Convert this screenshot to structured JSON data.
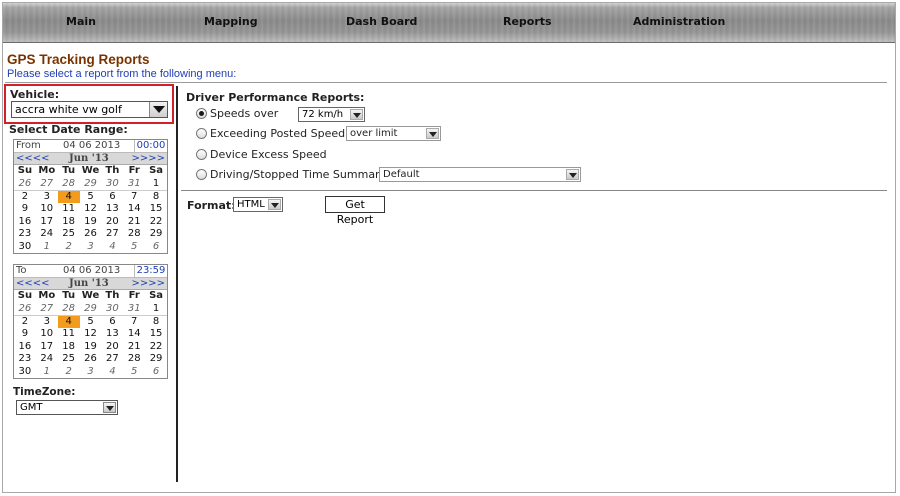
{
  "nav": [
    "Main",
    "Mapping",
    "Dash Board",
    "Reports",
    "Administration"
  ],
  "page": {
    "title": "GPS Tracking Reports",
    "subtitle": "Please select a report from the following menu:"
  },
  "vehicle": {
    "label": "Vehicle:",
    "value": "accra white vw golf"
  },
  "date_range_label": "Select Date Range:",
  "calendar_from": {
    "label": "From",
    "date": "04 06 2013",
    "time": "00:00",
    "prev": "<<<<",
    "month": "Jun '13",
    "next": ">>>>"
  },
  "calendar_to": {
    "label": "To",
    "date": "04 06 2013",
    "time": "23:59",
    "prev": "<<<<",
    "month": "Jun '13",
    "next": ">>>>"
  },
  "weekdays": [
    "Su",
    "Mo",
    "Tu",
    "We",
    "Th",
    "Fr",
    "Sa"
  ],
  "weeks": [
    [
      "26",
      "27",
      "28",
      "29",
      "30",
      "31",
      "1"
    ],
    [
      "2",
      "3",
      "4",
      "5",
      "6",
      "7",
      "8"
    ],
    [
      "9",
      "10",
      "11",
      "12",
      "13",
      "14",
      "15"
    ],
    [
      "16",
      "17",
      "18",
      "19",
      "20",
      "21",
      "22"
    ],
    [
      "23",
      "24",
      "25",
      "26",
      "27",
      "28",
      "29"
    ],
    [
      "30",
      "1",
      "2",
      "3",
      "4",
      "5",
      "6"
    ]
  ],
  "timezone": {
    "label": "TimeZone:",
    "value": "GMT"
  },
  "driver": {
    "title": "Driver Performance Reports:",
    "speeds_over": "Speeds over",
    "speeds_value": "72 km/h",
    "exceeding": "Exceeding Posted Speed",
    "exceeding_value": "over limit",
    "device_excess": "Device Excess Speed",
    "driving": "Driving/Stopped Time Summary",
    "driving_value": "Default"
  },
  "format": {
    "label": "Format:",
    "value": "HTML"
  },
  "get_report": "Get Report",
  "colors": {
    "title": "#7a3300",
    "link": "#1f3fb5",
    "today": "#f29b1d",
    "highlight": "#d0202a"
  }
}
